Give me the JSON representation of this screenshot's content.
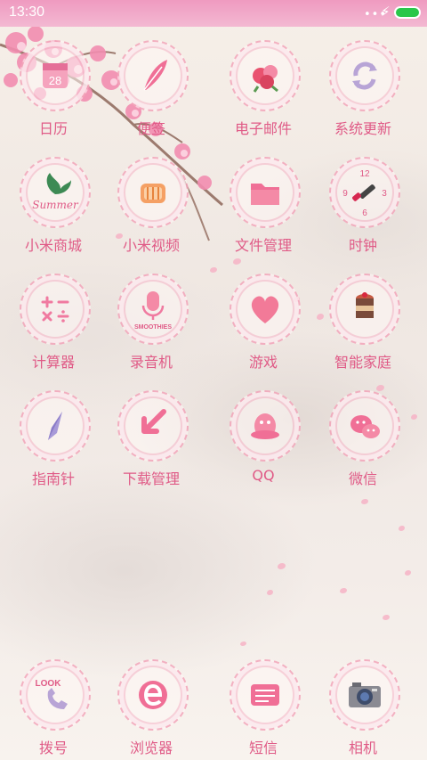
{
  "status_bar": {
    "time": "13:30",
    "battery_level": 1.0,
    "icons": [
      "dots-icon",
      "charging-bolt-icon",
      "battery-icon"
    ]
  },
  "colors": {
    "label_pink": "#e05b87",
    "accent_pink": "#f07aa0",
    "status_bar_pink": "#ef9ac0",
    "battery_green": "#29c74a"
  },
  "home": {
    "apps": [
      {
        "label": "日历",
        "icon": "calendar-icon"
      },
      {
        "label": "便签",
        "icon": "notes-feather-icon"
      },
      {
        "label": "电子邮件",
        "icon": "email-flower-icon"
      },
      {
        "label": "系统更新",
        "icon": "update-arrows-icon"
      },
      {
        "label": "小米商城",
        "icon": "store-leaf-icon"
      },
      {
        "label": "小米视频",
        "icon": "video-film-icon"
      },
      {
        "label": "文件管理",
        "icon": "folder-icon"
      },
      {
        "label": "时钟",
        "icon": "clock-lipstick-icon"
      },
      {
        "label": "计算器",
        "icon": "calculator-icon"
      },
      {
        "label": "录音机",
        "icon": "microphone-icon"
      },
      {
        "label": "游戏",
        "icon": "heart-icon"
      },
      {
        "label": "智能家庭",
        "icon": "cake-icon"
      },
      {
        "label": "指南针",
        "icon": "compass-icon"
      },
      {
        "label": "下载管理",
        "icon": "download-arrow-icon"
      },
      {
        "label": "QQ",
        "icon": "qq-penguin-icon"
      },
      {
        "label": "微信",
        "icon": "wechat-bubbles-icon"
      }
    ]
  },
  "dock": {
    "apps": [
      {
        "label": "拨号",
        "icon": "phone-icon"
      },
      {
        "label": "浏览器",
        "icon": "browser-e-icon"
      },
      {
        "label": "短信",
        "icon": "message-icon"
      },
      {
        "label": "相机",
        "icon": "camera-icon"
      }
    ]
  },
  "badge_texts": {
    "calendar_day": "28",
    "clock_12": "12",
    "clock_9": "9",
    "clock_3": "3",
    "clock_6": "6",
    "store_word": "Summer",
    "smoothies": "SMOOTHIES",
    "dialer_word": "LOOK"
  }
}
